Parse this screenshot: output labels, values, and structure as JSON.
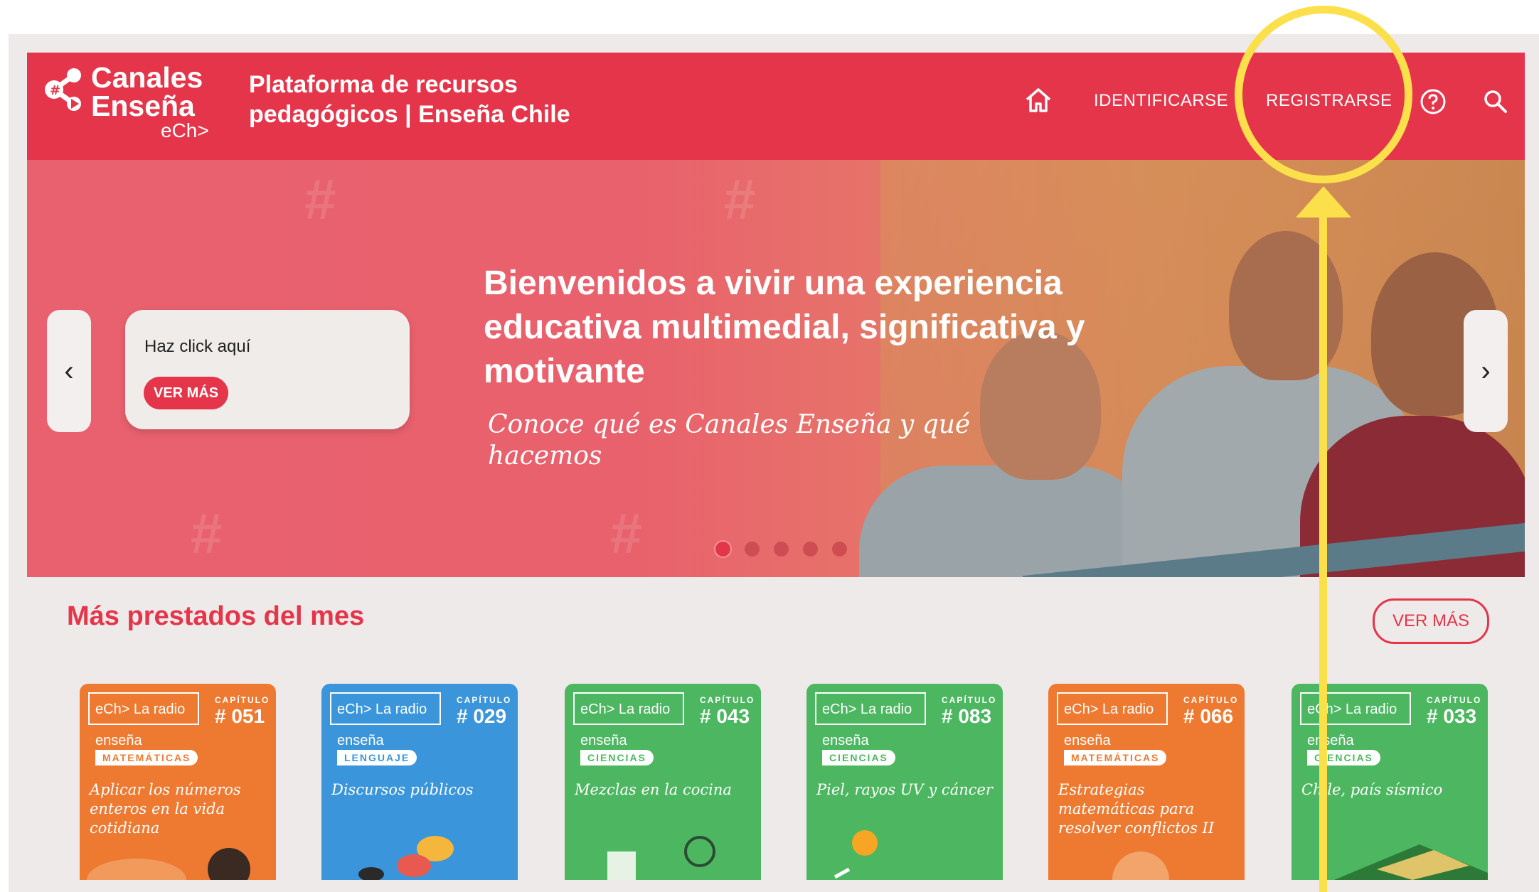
{
  "header": {
    "logo_line1": "Canales",
    "logo_line2": "Enseña",
    "logo_sub": "eCh>",
    "platform_title": "Plataforma de recursos pedagógicos | Enseña Chile",
    "nav": {
      "login": "IDENTIFICARSE",
      "register": "REGISTRARSE"
    }
  },
  "hero": {
    "headline": "Bienvenidos a vivir una experiencia educativa multimedial, significativa y motivante",
    "subline": "Conoce qué es Canales Enseña y qué hacemos",
    "promo_text": "Haz click aquí",
    "promo_button": "VER MÁS",
    "slide_count": 5,
    "active_slide": 1
  },
  "section": {
    "title": "Más prestados del mes",
    "more_button": "VER MÁS"
  },
  "cards": [
    {
      "logo": "eCh> La radio enseña",
      "cap_label": "CAPÍTULO",
      "chapter": "# 051",
      "subject": "MATEMÁTICAS",
      "title": "Aplicar los números enteros en la vida cotidiana",
      "color": "#ee7a32"
    },
    {
      "logo": "eCh> La radio enseña",
      "cap_label": "CAPÍTULO",
      "chapter": "# 029",
      "subject": "LENGUAJE",
      "title": "Discursos públicos",
      "color": "#3a95db"
    },
    {
      "logo": "eCh> La radio enseña",
      "cap_label": "CAPÍTULO",
      "chapter": "# 043",
      "subject": "CIENCIAS",
      "title": "Mezclas en la cocina",
      "color": "#4cb760"
    },
    {
      "logo": "eCh> La radio enseña",
      "cap_label": "CAPÍTULO",
      "chapter": "# 083",
      "subject": "CIENCIAS",
      "title": "Piel, rayos UV y cáncer",
      "color": "#4cb760"
    },
    {
      "logo": "eCh> La radio enseña",
      "cap_label": "CAPÍTULO",
      "chapter": "# 066",
      "subject": "MATEMÁTICAS",
      "title": "Estrategias matemáticas para resolver conflictos II",
      "color": "#ee7a32"
    },
    {
      "logo": "eCh> La radio enseña",
      "cap_label": "CAPÍTULO",
      "chapter": "# 033",
      "subject": "CIENCIAS",
      "title": "Chile, país sísmico",
      "color": "#4cb760"
    }
  ],
  "colors": {
    "brand_red": "#e5354a",
    "highlight_yellow": "#fce04b"
  },
  "icons": [
    "home-icon",
    "help-icon",
    "search-icon",
    "chevron-left-icon",
    "chevron-right-icon"
  ]
}
